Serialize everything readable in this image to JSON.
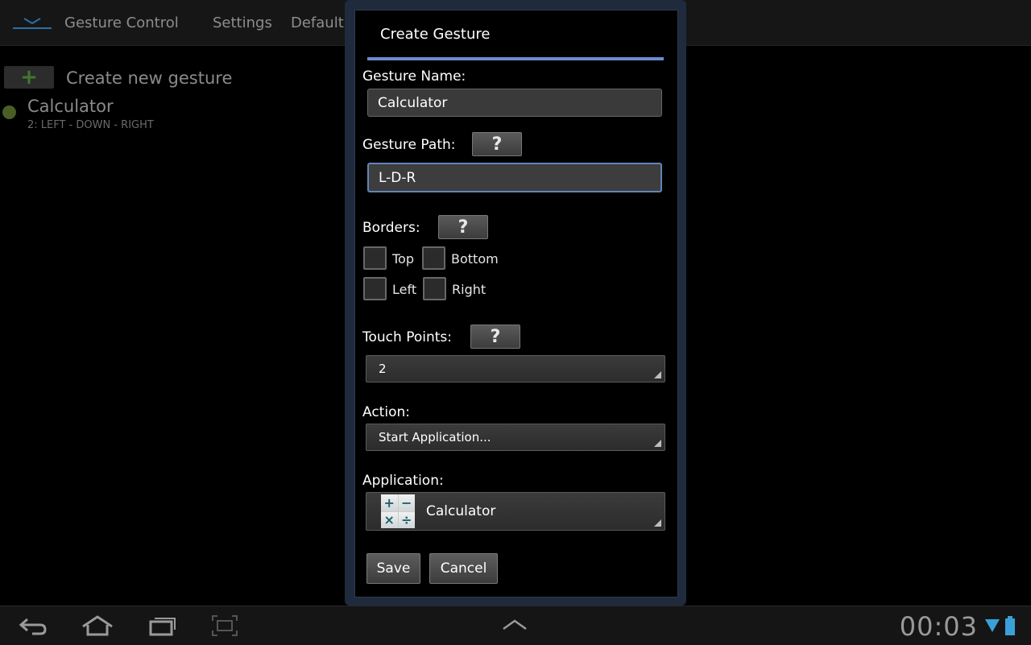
{
  "action_bar": {
    "app_title": "Gesture Control",
    "tabs": [
      "Settings",
      "Default G"
    ]
  },
  "background_list": {
    "create_new_label": "Create new gesture",
    "items": [
      {
        "title": "Calculator",
        "subtitle": "2: LEFT - DOWN - RIGHT"
      }
    ]
  },
  "dialog": {
    "title": "Create Gesture",
    "gesture_name_label": "Gesture Name:",
    "gesture_name_value": "Calculator",
    "gesture_path_label": "Gesture Path:",
    "gesture_path_value": "L-D-R",
    "help_label": "?",
    "borders_label": "Borders:",
    "borders": {
      "top": "Top",
      "bottom": "Bottom",
      "left": "Left",
      "right": "Right"
    },
    "touch_points_label": "Touch Points:",
    "touch_points_value": "2",
    "action_label": "Action:",
    "action_value": "Start Application...",
    "application_label": "Application:",
    "application_value": "Calculator",
    "calc_symbols": [
      "+",
      "−",
      "×",
      "÷"
    ],
    "save_label": "Save",
    "cancel_label": "Cancel"
  },
  "system_bar": {
    "clock": "00:03",
    "icons": [
      "back-icon",
      "home-icon",
      "recent-apps-icon",
      "screenshot-icon",
      "chevron-up-icon",
      "wifi-icon",
      "battery-icon"
    ]
  },
  "colors": {
    "accent": "#6b8cd1",
    "focus_border": "#5f86b8",
    "dialog_bg": "#000000"
  }
}
